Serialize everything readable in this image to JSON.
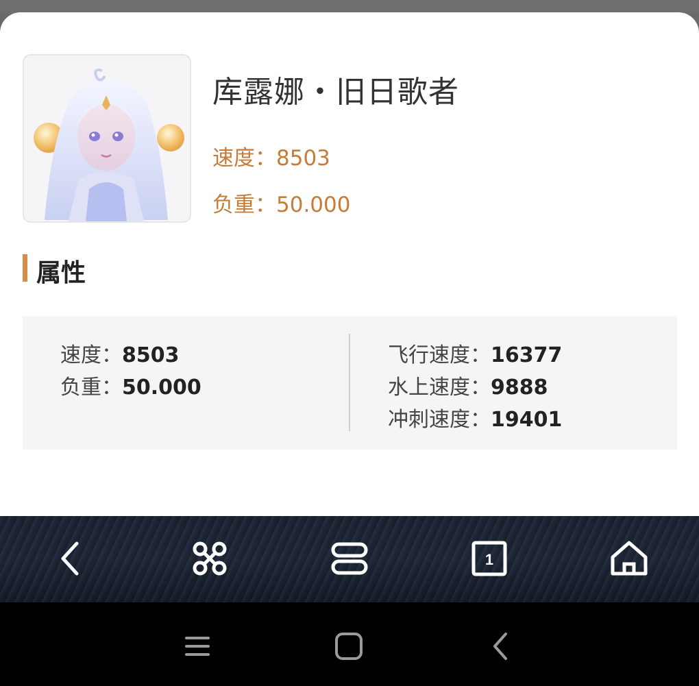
{
  "character": {
    "name": "库露娜・旧日歌者",
    "speed_line": "速度：8503",
    "load_line": "负重：50.000"
  },
  "section": {
    "title": "属性"
  },
  "attributes": {
    "left": [
      {
        "label": "速度：",
        "value": "8503"
      },
      {
        "label": "负重：",
        "value": "50.000"
      }
    ],
    "right": [
      {
        "label": "飞行速度：",
        "value": "16377"
      },
      {
        "label": "水上速度：",
        "value": "9888"
      },
      {
        "label": "冲刺速度：",
        "value": "19401"
      }
    ]
  },
  "browser_toolbar": {
    "tab_count": "1",
    "icons": [
      "back-icon",
      "command-icon",
      "menu-icon",
      "tabs-icon",
      "home-icon"
    ]
  },
  "system_nav": {
    "icons": [
      "recent-apps-icon",
      "home-icon",
      "back-icon"
    ]
  },
  "colors": {
    "accent": "#c47d38",
    "section_bar": "#d98a45"
  }
}
